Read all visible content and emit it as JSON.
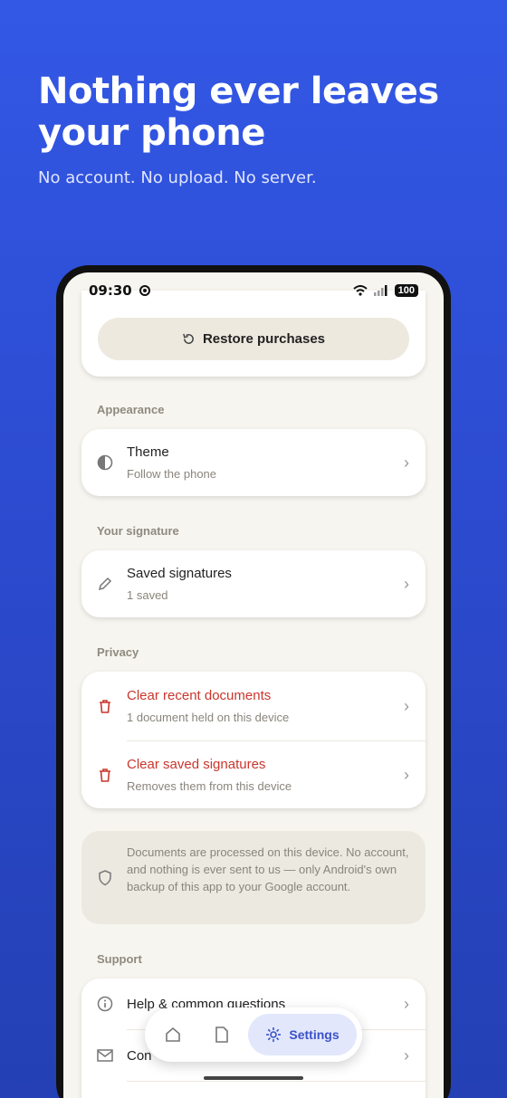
{
  "hero": {
    "title": "Nothing ever leaves your phone",
    "subtitle": "No account. No upload. No server."
  },
  "statusbar": {
    "time": "09:30",
    "battery": "100"
  },
  "restore": {
    "label": "Restore purchases",
    "icon": "restore-icon"
  },
  "sections": {
    "appearance": "Appearance",
    "signature": "Your signature",
    "privacy": "Privacy",
    "support": "Support"
  },
  "theme": {
    "title": "Theme",
    "sub": "Follow the phone",
    "icon": "contrast-icon"
  },
  "saved_signatures": {
    "title": "Saved signatures",
    "sub": "1 saved",
    "icon": "pen-icon"
  },
  "privacy": {
    "clear_docs": {
      "title": "Clear recent documents",
      "sub": "1 document held on this device",
      "icon": "trash-icon"
    },
    "clear_sigs": {
      "title": "Clear saved signatures",
      "sub": "Removes them from this device",
      "icon": "trash-icon"
    }
  },
  "info": {
    "text": "Documents are processed on this device. No account, and nothing is ever sent to us — only Android's own backup of this app to your Google account.",
    "icon": "shield-icon"
  },
  "support": {
    "help": {
      "title": "Help & common questions",
      "icon": "info-icon"
    },
    "contact": {
      "title": "Con",
      "icon": "mail-icon"
    }
  },
  "nav": {
    "active_label": "Settings",
    "items": [
      "home-icon",
      "document-icon",
      "settings-icon"
    ]
  },
  "colors": {
    "accent": "#3a52c8",
    "danger": "#c9362c",
    "background": "#3358e6"
  }
}
